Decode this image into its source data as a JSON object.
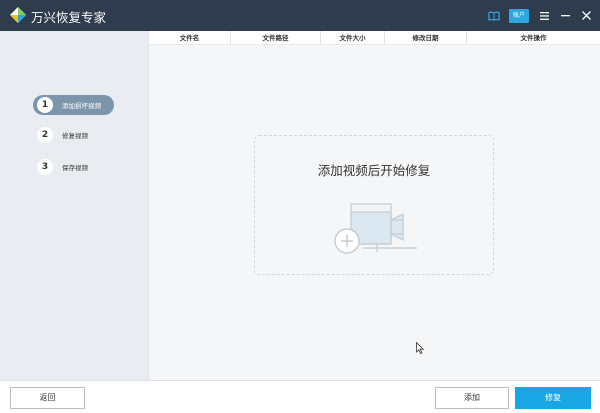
{
  "titlebar": {
    "title": "万兴恢复专家",
    "account_label": "账户",
    "icons": [
      "app-logo",
      "book-icon",
      "menu-icon",
      "minimize-icon",
      "close-icon"
    ]
  },
  "sidebar": {
    "steps": [
      {
        "number": "1",
        "label": "添加损坏视频",
        "active": true
      },
      {
        "number": "2",
        "label": "修复视频",
        "active": false
      },
      {
        "number": "3",
        "label": "保存视频",
        "active": false
      }
    ]
  },
  "table": {
    "columns": [
      "文件名",
      "文件路径",
      "文件大小",
      "修改日期",
      "文件操作"
    ]
  },
  "dropzone": {
    "text": "添加视频后开始修复",
    "icon": "add-video-illustration"
  },
  "buttons": {
    "back": "返回",
    "add": "添加",
    "repair": "修复"
  },
  "colors": {
    "titlebar": "#2f3c4d",
    "sidebar": "#e9edf1",
    "active_step": "#7d95ab",
    "primary_button": "#18a6e5",
    "account_badge": "#2ea7e0"
  }
}
